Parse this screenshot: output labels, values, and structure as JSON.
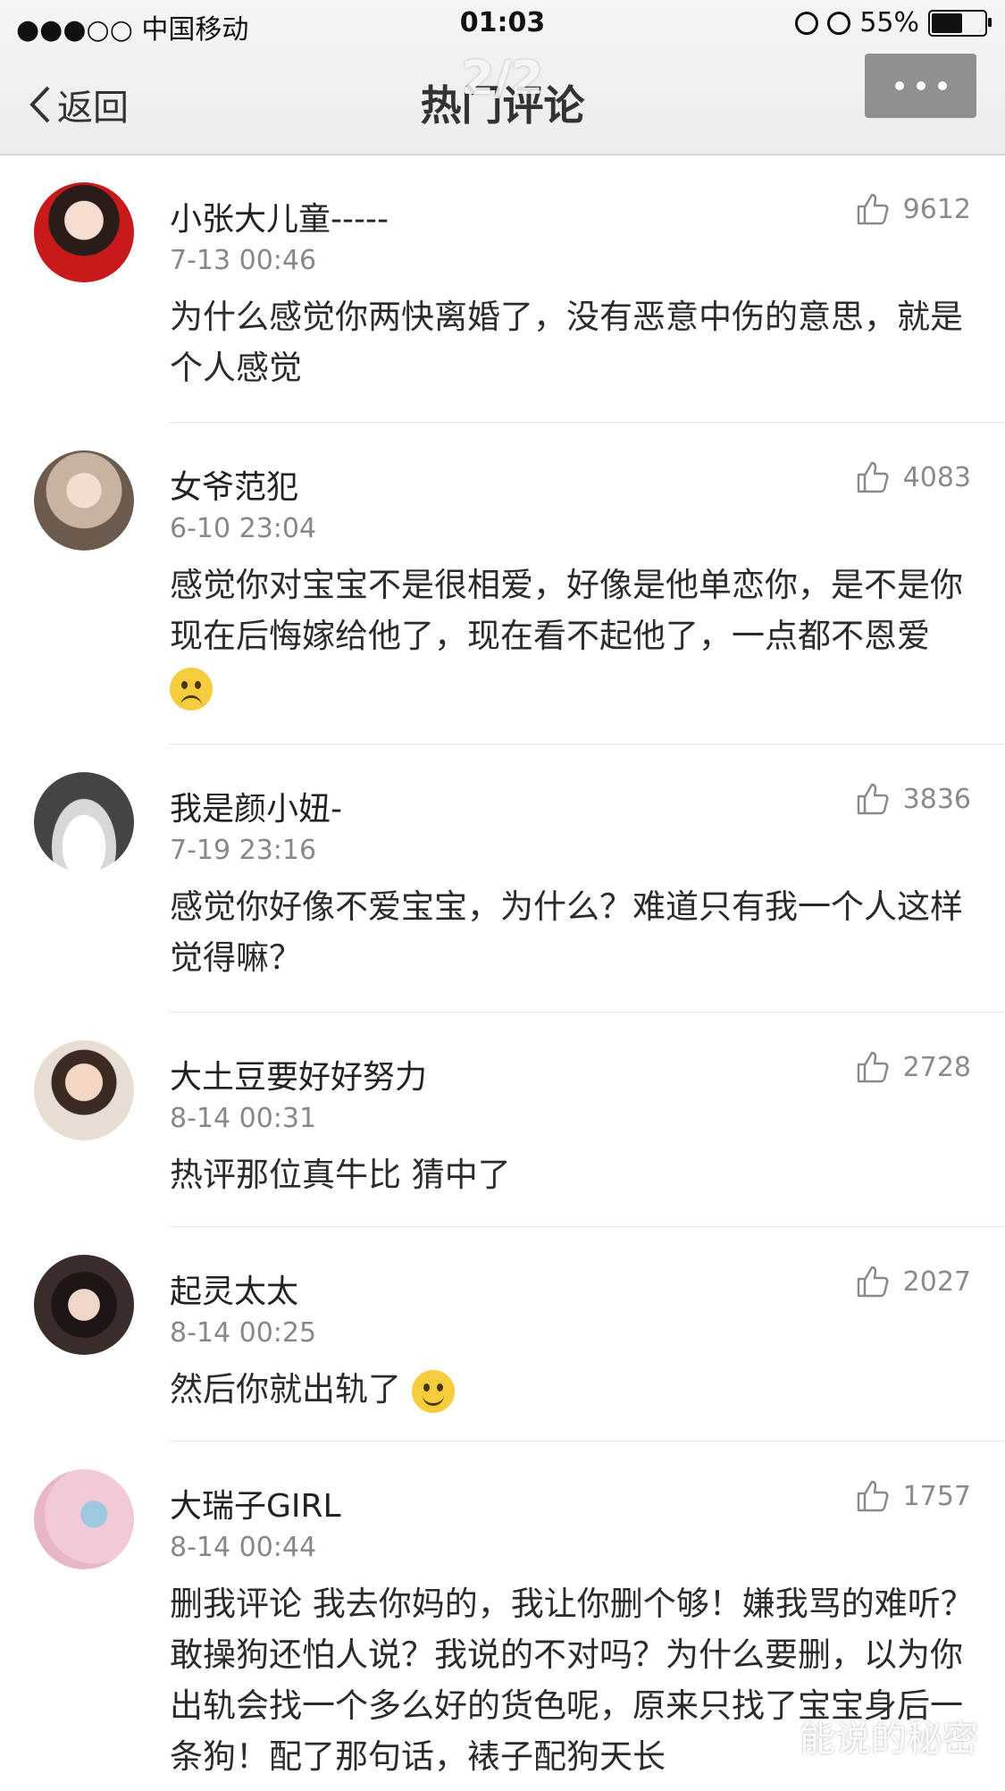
{
  "status_bar": {
    "carrier": "●●●○○ 中国移动",
    "time": "01:03",
    "battery": "55%"
  },
  "nav": {
    "back_label": "返回",
    "title": "热门评论",
    "pager": "2/2"
  },
  "comments": [
    {
      "name": "小张大儿童-----",
      "date": "7-13 00:46",
      "likes": "9612",
      "text": "为什么感觉你两快离婚了，没有恶意中伤的意思，就是个人感觉"
    },
    {
      "name": "女爷范犯",
      "date": "6-10 23:04",
      "likes": "4083",
      "text": "感觉你对宝宝不是很相爱，好像是他单恋你，是不是你现在后悔嫁给他了，现在看不起他了，一点都不恩爱"
    },
    {
      "name": "我是颜小妞-",
      "date": "7-19 23:16",
      "likes": "3836",
      "text": "感觉你好像不爱宝宝，为什么？难道只有我一个人这样觉得嘛？"
    },
    {
      "name": "大土豆要好好努力",
      "date": "8-14 00:31",
      "likes": "2728",
      "text": "热评那位真牛比 猜中了"
    },
    {
      "name": "起灵太太",
      "date": "8-14 00:25",
      "likes": "2027",
      "text": "然后你就出轨了"
    },
    {
      "name": "大瑞子GIRL",
      "date": "8-14 00:44",
      "likes": "1757",
      "text": "删我评论 我去你妈的，我让你删个够！嫌我骂的难听？敢操狗还怕人说？我说的不对吗？为什么要删，以为你出轨会找一个多么好的货色呢，原来只找了宝宝身后一条狗！配了那句话，裱子配狗天长"
    }
  ],
  "watermark": "能说的秘密"
}
